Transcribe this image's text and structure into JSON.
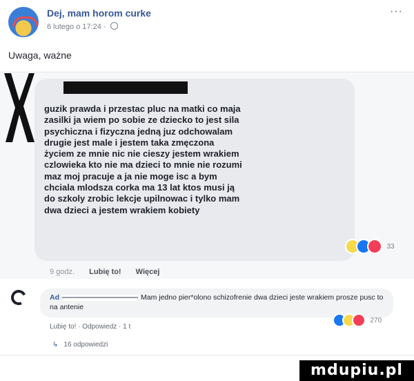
{
  "post": {
    "author": "Dej, mam horom curke",
    "timestamp": "6 lutego o 17:24",
    "text": "Uwaga, ważne",
    "more_label": "···"
  },
  "shared": {
    "lines": [
      "guzik prawda i przestac pluc na matki co maja",
      "zasilki ja wiem po sobie ze dziecko to jest sila",
      "psychiczna i fizyczna jedną juz odchowalam",
      "drugie jest male i jestem taka zmęczona",
      "życiem ze mnie nic nie cieszy jestem wrakiem",
      "czlowieka kto nie ma dzieci to mnie nie rozumi",
      "maz moj pracuje a ja nie moge isc a bym",
      "chciala mlodsza corka ma 13 lat ktos musi ją",
      "do szkoly zrobic lekcje upilnowac i tylko mam",
      "dwa dzieci a jestem wrakiem kobiety"
    ],
    "reaction_count": "33",
    "time": "9 godz.",
    "like_label": "Lubię to!",
    "more_label": "Więcej"
  },
  "comment": {
    "author": "Ad",
    "text": "Mam jedno pier*olono schizofrenie dwa dzieci jeste wrakiem prosze pusc to na antenie",
    "reaction_count": "270",
    "actions": "Lubię to! · Odpowiedz · 1 t",
    "replies": "16 odpowiedzi"
  },
  "watermark": "mdupiu.pl"
}
